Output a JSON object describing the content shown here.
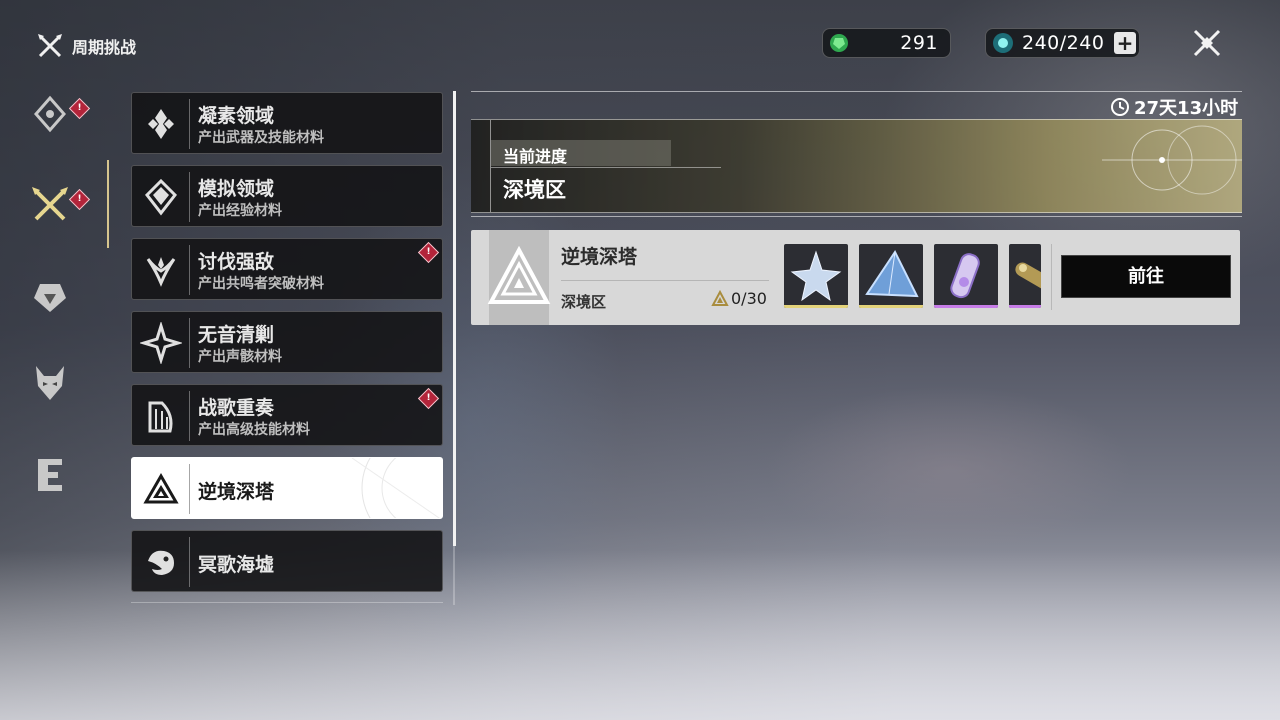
{
  "header": {
    "title": "周期挑战",
    "currency_1": "291",
    "currency_2": "240/240",
    "plus_label": "+"
  },
  "rail": {
    "badge_text": "!"
  },
  "menu": {
    "items": [
      {
        "name": "凝素领域",
        "desc": "产出武器及技能材料"
      },
      {
        "name": "模拟领域",
        "desc": "产出经验材料"
      },
      {
        "name": "讨伐强敌",
        "desc": "产出共鸣者突破材料"
      },
      {
        "name": "无音清剿",
        "desc": "产出声骸材料"
      },
      {
        "name": "战歌重奏",
        "desc": "产出高级技能材料"
      },
      {
        "name": "逆境深塔",
        "desc": ""
      },
      {
        "name": "冥歌海墟",
        "desc": ""
      }
    ]
  },
  "panel": {
    "timer": "27天13小时",
    "progress_label": "当前进度",
    "progress_zone": "深境区",
    "challenge_title": "逆境深塔",
    "challenge_zone": "深境区",
    "challenge_count": "0/30",
    "goto_label": "前往"
  },
  "colors": {
    "accent_gold": "#d6c58e",
    "badge_red": "#b3243a",
    "reward_gold": "#e3d27a",
    "reward_purple": "#c77de8"
  }
}
